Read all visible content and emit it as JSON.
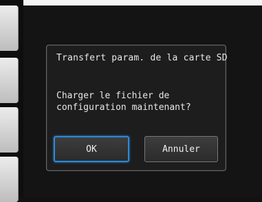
{
  "dialog": {
    "title": "Transfert param. de la carte SD",
    "message": "Charger le fichier de\nconfiguration maintenant?",
    "buttons": {
      "ok_label": "OK",
      "cancel_label": "Annuler"
    }
  },
  "colors": {
    "focus_outline": "#2b8ad8",
    "dialog_background": "#1d1d1d",
    "text": "#e8e8e8"
  }
}
